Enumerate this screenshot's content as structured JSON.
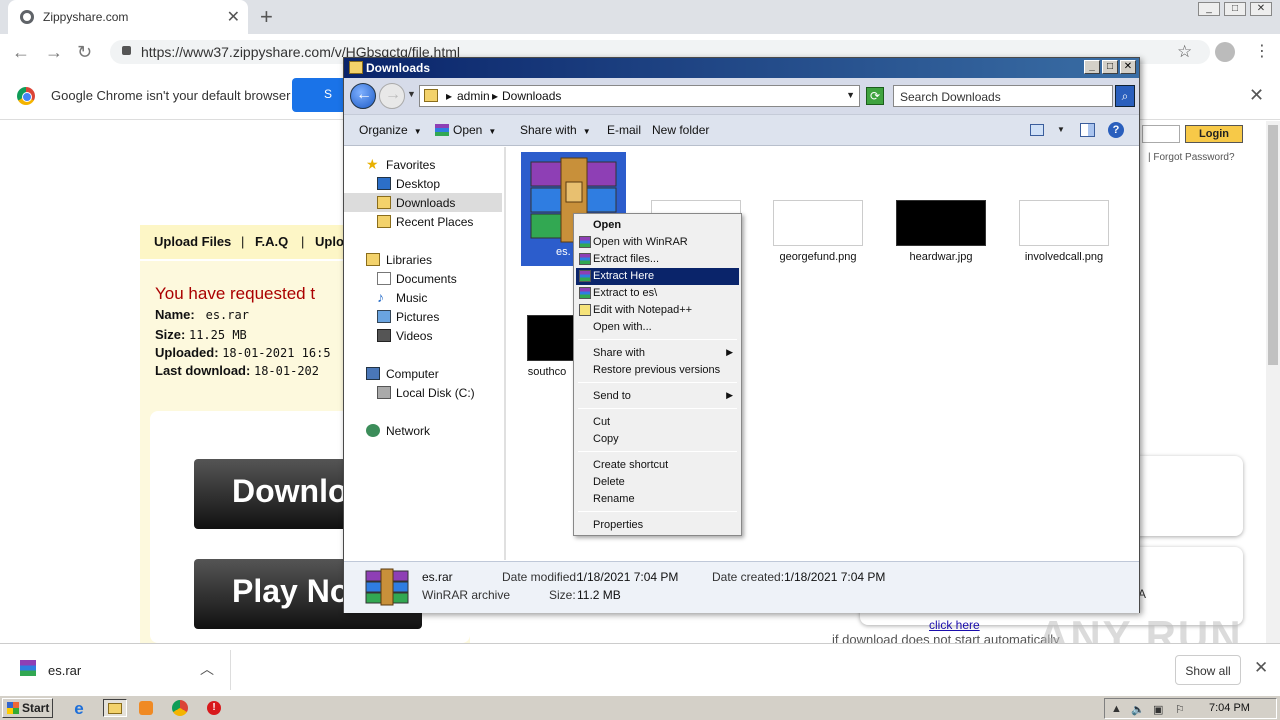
{
  "browser": {
    "tab_title": "Zippyshare.com",
    "url": "https://www37.zippyshare.com/v/HGbsqctg/file.html",
    "infobar_message": "Google Chrome isn't your default browser",
    "infobar_button": "S"
  },
  "zippyshare": {
    "nav_links": [
      "Upload Files",
      "F.A.Q",
      "Uplo"
    ],
    "requested_text": "You have requested t",
    "name_label": "Name:",
    "name_value": "es.rar",
    "size_label": "Size:",
    "size_value": "11.25 MB",
    "uploaded_label": "Uploaded:",
    "uploaded_value": "18-01-2021 16:5",
    "lastdl_label": "Last download:",
    "lastdl_value": "18-01-202",
    "download_button": "Downlo",
    "play_button": "Play No",
    "login_button": "Login",
    "forgot_password": "| Forgot Password?",
    "auto_download_text": "if download does not start automatically",
    "click_here": "click here",
    "fa_text": "A"
  },
  "explorer": {
    "title": "Downloads",
    "breadcrumb": [
      "admin",
      "Downloads"
    ],
    "search_placeholder": "Search Downloads",
    "commands": {
      "organize": "Organize",
      "open": "Open",
      "share_with": "Share with",
      "email": "E-mail",
      "new_folder": "New folder"
    },
    "nav": {
      "favorites": "Favorites",
      "desktop": "Desktop",
      "downloads": "Downloads",
      "recent": "Recent Places",
      "libraries": "Libraries",
      "documents": "Documents",
      "music": "Music",
      "pictures": "Pictures",
      "videos": "Videos",
      "computer": "Computer",
      "local_disk": "Local Disk (C:)",
      "network": "Network"
    },
    "files": {
      "selected": "es.",
      "georgefund": "georgefund.png",
      "heardwar": "heardwar.jpg",
      "involvedcall": "involvedcall.png",
      "southco": "southco"
    },
    "details": {
      "name": "es.rar",
      "type": "WinRAR archive",
      "modified_label": "Date modified:",
      "modified_value": "1/18/2021 7:04 PM",
      "created_label": "Date created:",
      "created_value": "1/18/2021 7:04 PM",
      "size_label": "Size:",
      "size_value": "11.2 MB"
    }
  },
  "context_menu": {
    "open": "Open",
    "open_with_winrar": "Open with WinRAR",
    "extract_files": "Extract files...",
    "extract_here": "Extract Here",
    "extract_to": "Extract to es\\",
    "edit_notepad": "Edit with Notepad++",
    "open_with": "Open with...",
    "share_with": "Share with",
    "restore": "Restore previous versions",
    "send_to": "Send to",
    "cut": "Cut",
    "copy": "Copy",
    "create_shortcut": "Create shortcut",
    "delete": "Delete",
    "rename": "Rename",
    "properties": "Properties"
  },
  "shelf": {
    "download_name": "es.rar",
    "show_all": "Show all"
  },
  "watermark": "ANY RUN",
  "taskbar": {
    "start": "Start",
    "time": "7:04 PM"
  }
}
